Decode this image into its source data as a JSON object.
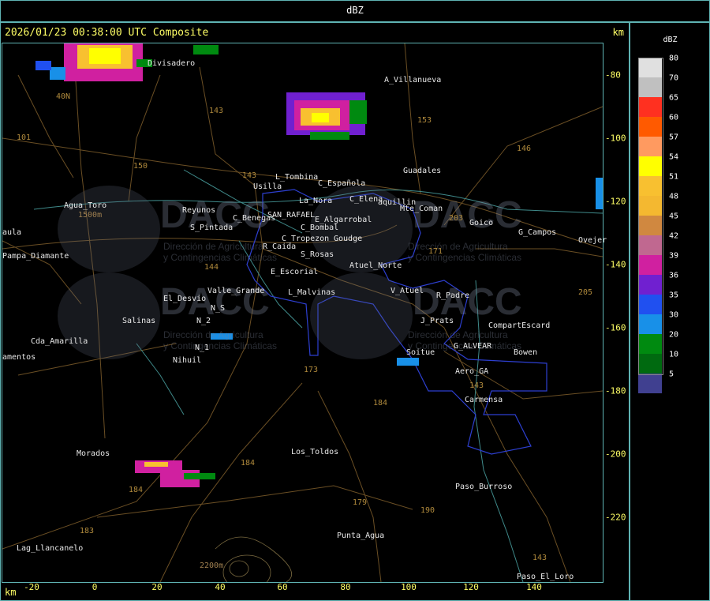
{
  "topbar": {
    "title": "dBZ"
  },
  "header": {
    "timestamp": "2026/01/23 00:38:00 UTC Composite",
    "unit_top": "km",
    "unit_bottom": "km"
  },
  "axes": {
    "x_ticks": [
      "-20",
      "0",
      "20",
      "40",
      "60",
      "80",
      "100",
      "120",
      "140"
    ],
    "y_ticks": [
      "-80",
      "-100",
      "-120",
      "-140",
      "-160",
      "-180",
      "-200",
      "-220"
    ]
  },
  "legend": {
    "title": "dBZ",
    "items": [
      {
        "label": "80",
        "color": "#e0e0e0"
      },
      {
        "label": "70",
        "color": "#c0c0c0"
      },
      {
        "label": "65",
        "color": "#ff3020"
      },
      {
        "label": "60",
        "color": "#ff5a00"
      },
      {
        "label": "57",
        "color": "#ff9a60"
      },
      {
        "label": "54",
        "color": "#ffff00"
      },
      {
        "label": "51",
        "color": "#f8c030"
      },
      {
        "label": "48",
        "color": "#f4b830"
      },
      {
        "label": "45",
        "color": "#d08840"
      },
      {
        "label": "42",
        "color": "#c06890"
      },
      {
        "label": "39",
        "color": "#d020a0"
      },
      {
        "label": "36",
        "color": "#7020d0"
      },
      {
        "label": "35",
        "color": "#2050f0"
      },
      {
        "label": "30",
        "color": "#1890e8"
      },
      {
        "label": "20",
        "color": "#008a10"
      },
      {
        "label": "10",
        "color": "#006a10"
      },
      {
        "label": "5",
        "color": "#404090"
      }
    ]
  },
  "places": [
    {
      "name": "Divisadero"
    },
    {
      "name": "A_Villanueva"
    },
    {
      "name": "Guadales"
    },
    {
      "name": "L_Tombina"
    },
    {
      "name": "C_Española"
    },
    {
      "name": "Usilla"
    },
    {
      "name": "La_Nora"
    },
    {
      "name": "C_Elena"
    },
    {
      "name": "aquillin"
    },
    {
      "name": "Mte_Coman"
    },
    {
      "name": "Agua_Toro"
    },
    {
      "name": "C_Benegas"
    },
    {
      "name": "SAN_RAFAEL"
    },
    {
      "name": "E_Algarrobal"
    },
    {
      "name": "Goudge"
    },
    {
      "name": "Reyunos"
    },
    {
      "name": "Goico"
    },
    {
      "name": "G_Campos"
    },
    {
      "name": "S_Pintada"
    },
    {
      "name": "C_Bombal"
    },
    {
      "name": "Pampa_Diamante"
    },
    {
      "name": "R_Caida"
    },
    {
      "name": "C_Tropezon"
    },
    {
      "name": "S_Rosas"
    },
    {
      "name": "Atuel_Norte"
    },
    {
      "name": "E_Escorial"
    },
    {
      "name": "Valle_Grande"
    },
    {
      "name": "L_Malvinas"
    },
    {
      "name": "V_Atuel"
    },
    {
      "name": "R_Padre"
    },
    {
      "name": "El_Desvio"
    },
    {
      "name": "Salinas"
    },
    {
      "name": "J_Prats"
    },
    {
      "name": "CompartEscard"
    },
    {
      "name": "Cda_Amarilla"
    },
    {
      "name": "Soitue"
    },
    {
      "name": "G_ALVEAR"
    },
    {
      "name": "Bowen"
    },
    {
      "name": "Nihuil"
    },
    {
      "name": "Aero_GA"
    },
    {
      "name": "Carmensa"
    },
    {
      "name": "Morados"
    },
    {
      "name": "Los_Toldos"
    },
    {
      "name": "Paso_Burroso"
    },
    {
      "name": "Punta_Agua"
    },
    {
      "name": "Lag_Llancanelo"
    },
    {
      "name": "Paso_El_Loro"
    },
    {
      "name": "Ovejer"
    },
    {
      "name": "amentos"
    },
    {
      "name": "aula"
    },
    {
      "name": "N_S"
    },
    {
      "name": "N_1"
    },
    {
      "name": "N_2"
    },
    {
      "name": "1500m"
    },
    {
      "name": "2200m"
    }
  ],
  "roads": [
    "143",
    "153",
    "101",
    "150",
    "40N",
    "143",
    "146",
    "203",
    "171",
    "144",
    "205",
    "173",
    "184",
    "190",
    "179",
    "184",
    "143",
    "183",
    "184",
    "143"
  ],
  "watermark": {
    "brand": "DACC",
    "line1": "Dirección de Agricultura",
    "line2": "y Contingencias Climáticas"
  }
}
